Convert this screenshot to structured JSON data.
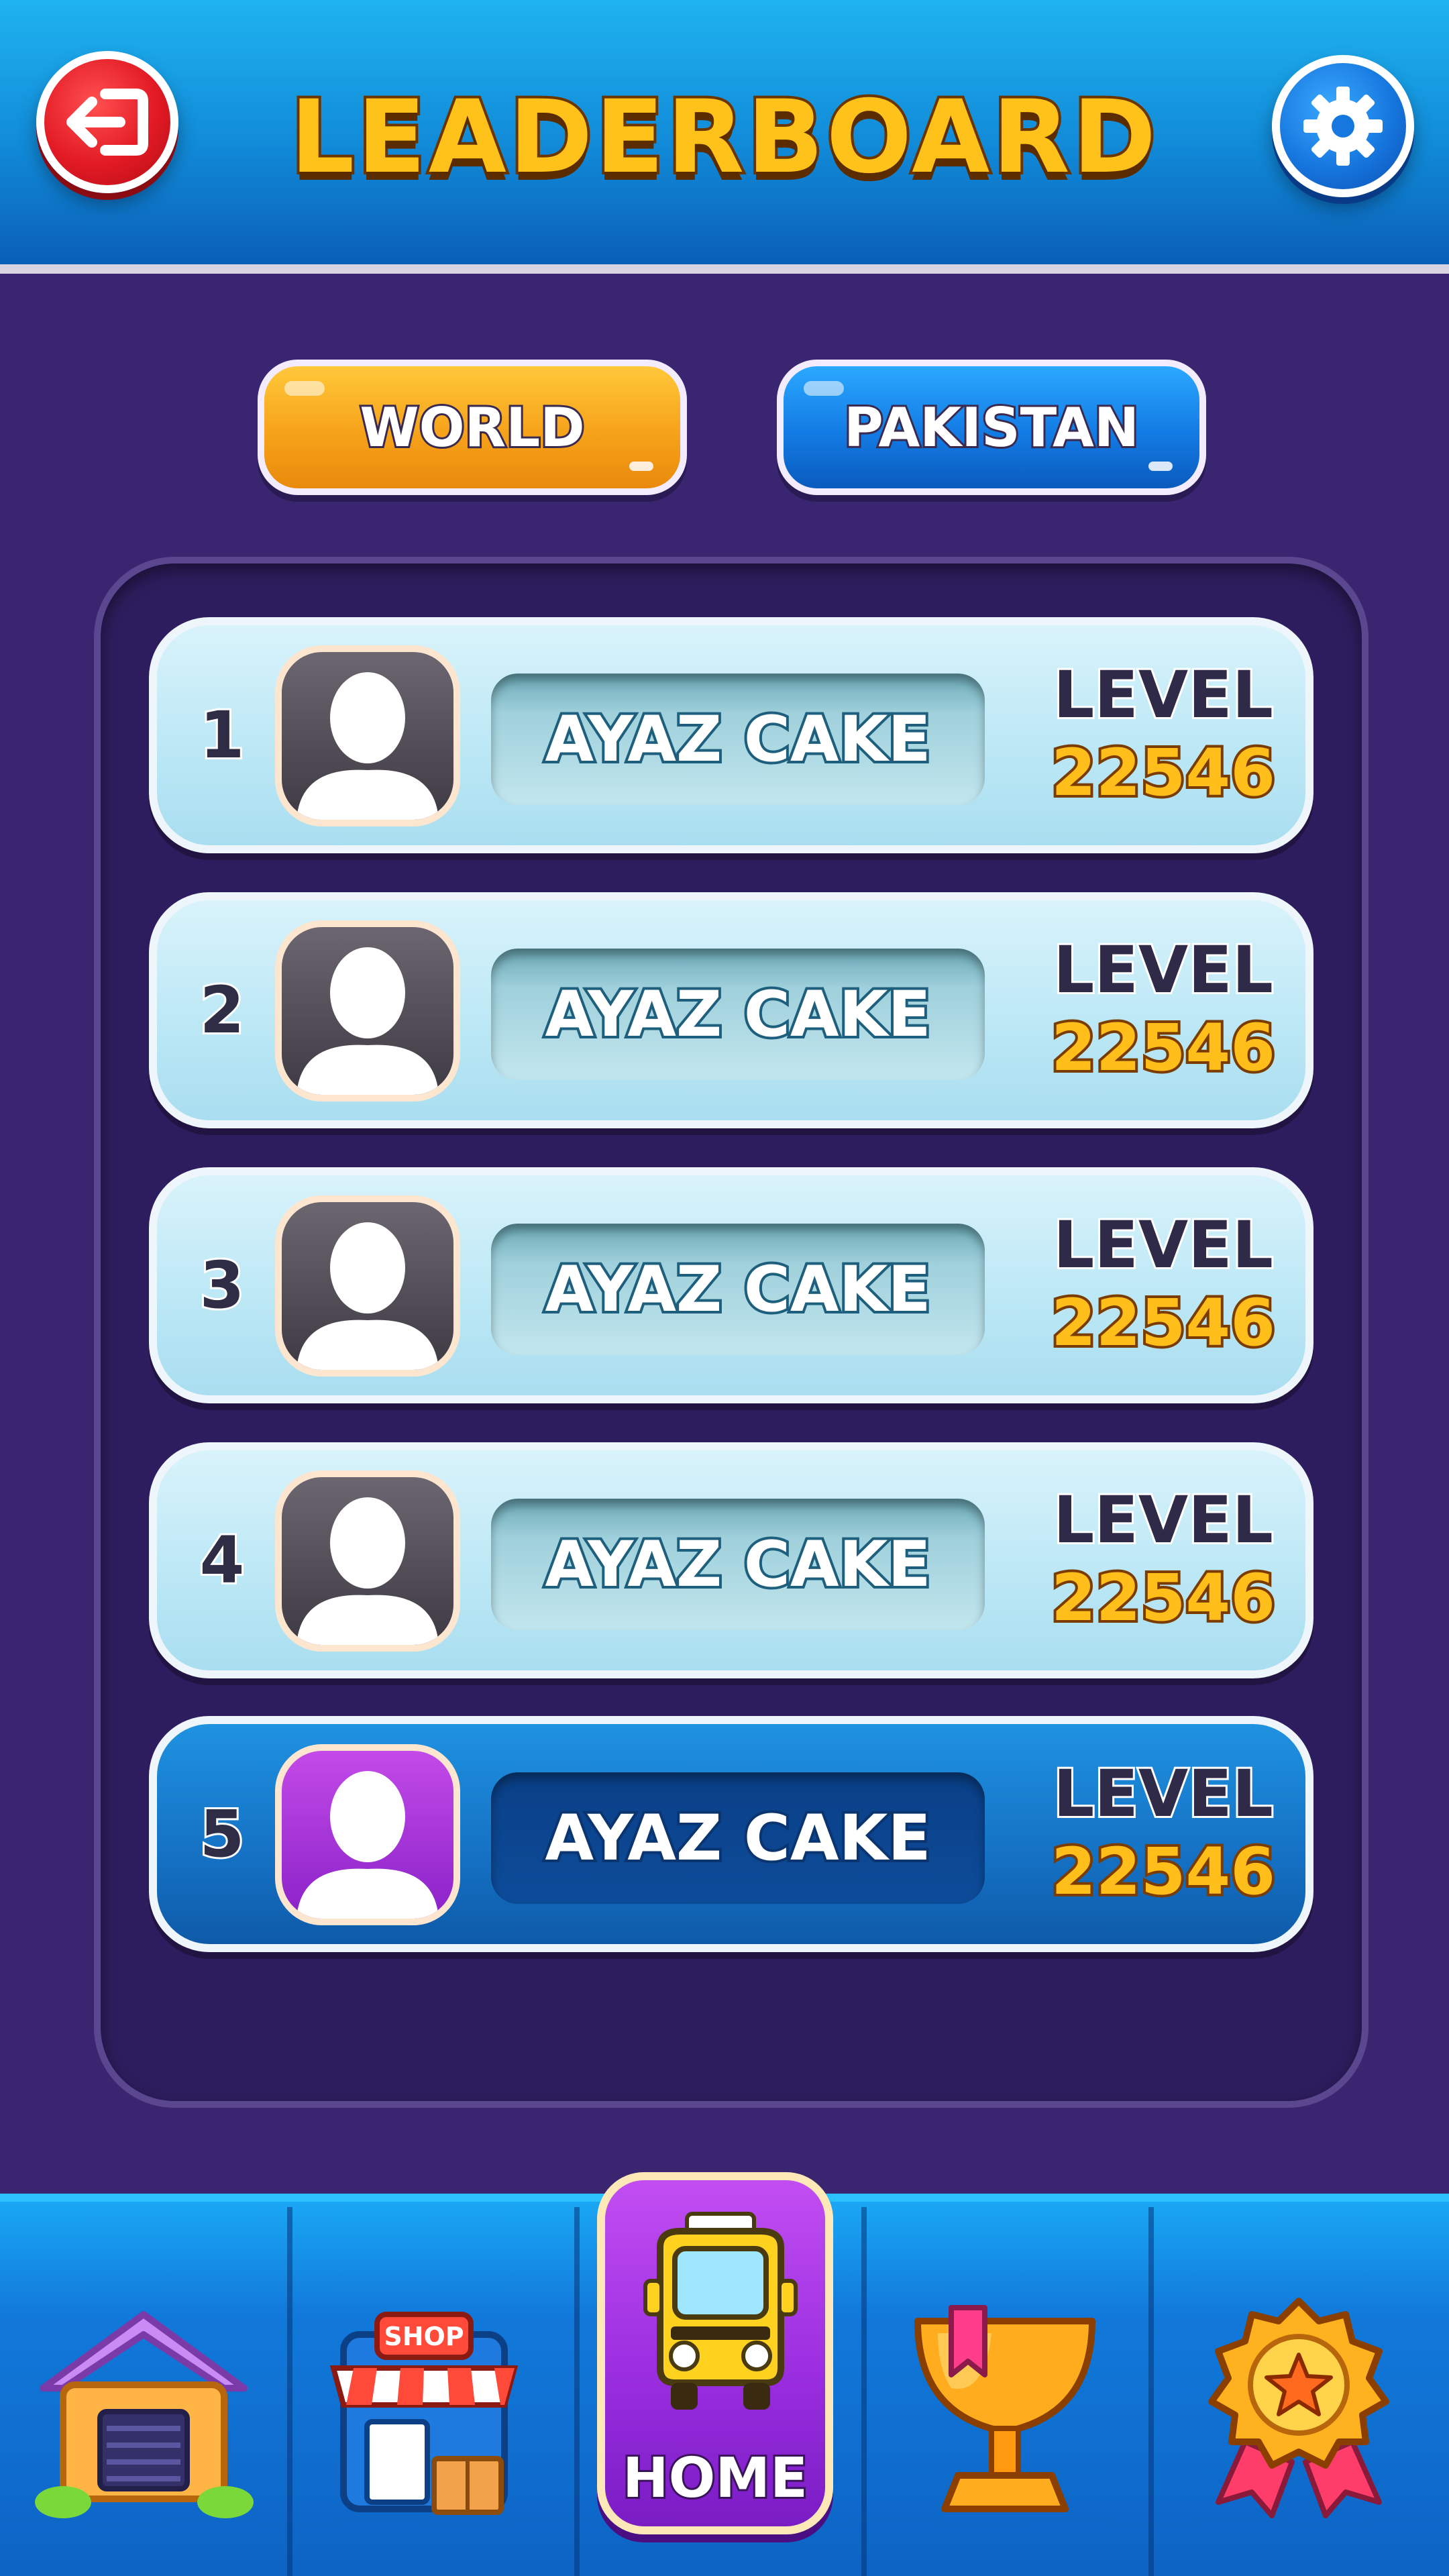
{
  "header": {
    "title": "LEADERBOARD",
    "exit_icon": "exit-icon",
    "settings_icon": "gear-icon"
  },
  "tabs": [
    {
      "label": "WORLD",
      "active": true,
      "color": "#f6a21a"
    },
    {
      "label": "PAKISTAN",
      "active": false,
      "color": "#137be4"
    }
  ],
  "leaderboard": {
    "level_label": "LEVEL",
    "rows": [
      {
        "rank": "1",
        "name": "AYAZ CAKE",
        "level": "22546",
        "current_user": false
      },
      {
        "rank": "2",
        "name": "AYAZ CAKE",
        "level": "22546",
        "current_user": false
      },
      {
        "rank": "3",
        "name": "AYAZ CAKE",
        "level": "22546",
        "current_user": false
      },
      {
        "rank": "4",
        "name": "AYAZ CAKE",
        "level": "22546",
        "current_user": false
      },
      {
        "rank": "5",
        "name": "AYAZ CAKE",
        "level": "22546",
        "current_user": true
      }
    ]
  },
  "nav": {
    "items": [
      {
        "icon": "house-icon"
      },
      {
        "icon": "shop-icon",
        "sign": "SHOP"
      },
      {
        "icon": "taxi-icon",
        "label": "HOME",
        "active": true
      },
      {
        "icon": "trophy-icon"
      },
      {
        "icon": "medal-icon"
      }
    ]
  },
  "colors": {
    "background": "#3a2570",
    "header": "#118ad8",
    "accent_gold": "#ffbe1a",
    "current_user_row": "#1571c4"
  }
}
